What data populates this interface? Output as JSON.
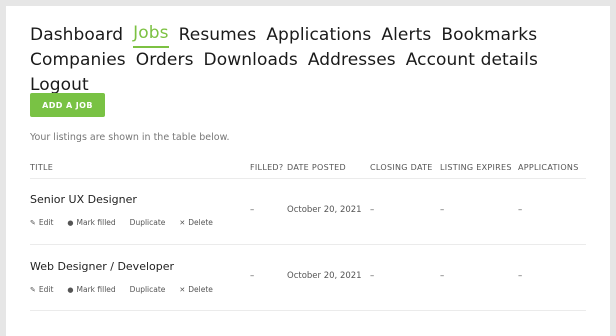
{
  "nav": {
    "items": [
      "Dashboard",
      "Jobs",
      "Resumes",
      "Applications",
      "Alerts",
      "Bookmarks",
      "Companies",
      "Orders",
      "Downloads",
      "Addresses",
      "Account details",
      "Logout"
    ]
  },
  "add_job_label": "ADD A JOB",
  "intro_text": "Your listings are shown in the table below.",
  "table": {
    "headers": [
      "TITLE",
      "FILLED?",
      "DATE POSTED",
      "CLOSING DATE",
      "LISTING EXPIRES",
      "APPLICATIONS"
    ],
    "action_labels": [
      "Edit",
      "Mark filled",
      "Duplicate",
      "Delete"
    ],
    "action_icons": [
      "pencil-icon",
      "dot-icon",
      "",
      "x-icon"
    ],
    "rows": [
      {
        "title": "Senior UX Designer",
        "filled": "–",
        "date_posted": "October 20, 2021",
        "closing_date": "–",
        "listing_expires": "–",
        "applications": "–"
      },
      {
        "title": "Web Designer / Developer",
        "filled": "–",
        "date_posted": "October 20, 2021",
        "closing_date": "–",
        "listing_expires": "–",
        "applications": "–"
      }
    ]
  },
  "colors": {
    "accent": "#79c244",
    "active_nav": "#7cc142",
    "background": "#e6e6e6"
  }
}
